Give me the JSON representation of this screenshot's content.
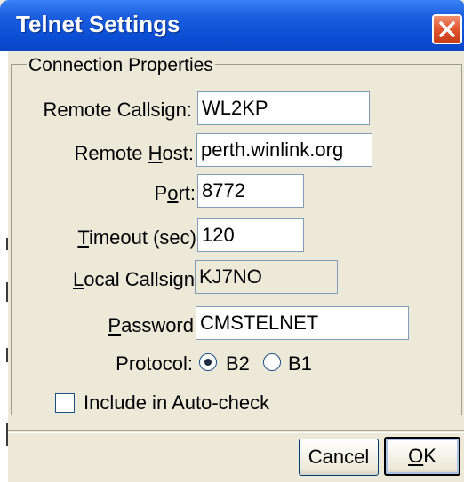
{
  "window": {
    "title": "Telnet Settings",
    "close_icon": "close-icon"
  },
  "group": {
    "legend": "Connection Properties"
  },
  "fields": {
    "remote_callsign": {
      "label": "Remote Callsign:",
      "value": "WL2KP"
    },
    "remote_host": {
      "label_pre": "Remote ",
      "label_ul": "H",
      "label_post": "ost:",
      "value": "perth.winlink.org"
    },
    "port": {
      "label_pre": "P",
      "label_ul": "o",
      "label_post": "rt:",
      "value": "8772"
    },
    "timeout": {
      "label_ul": "T",
      "label_post": "imeout (sec)",
      "value": "120"
    },
    "local_callsign": {
      "label_ul": "L",
      "label_post": "ocal Callsign",
      "value": "KJ7NO"
    },
    "password": {
      "label_ul": "P",
      "label_post": "assword",
      "value": "CMSTELNET"
    }
  },
  "protocol": {
    "label": "Protocol:",
    "options": [
      "B2",
      "B1"
    ],
    "selected": "B2"
  },
  "autocheck": {
    "label": "Include in Auto-check",
    "checked": false
  },
  "buttons": {
    "cancel": "Cancel",
    "ok_ul": "O",
    "ok_post": "K"
  }
}
